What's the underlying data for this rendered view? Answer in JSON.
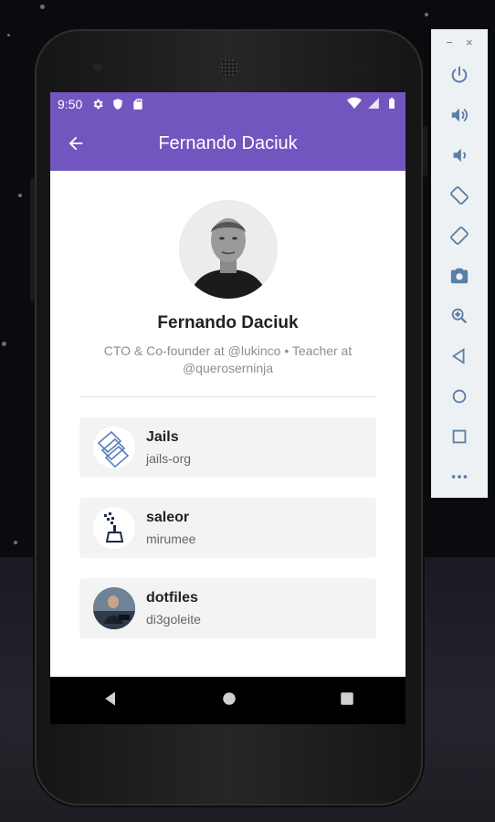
{
  "status_bar": {
    "time": "9:50",
    "left_icons": [
      "settings-icon",
      "shield-icon",
      "sd-card-icon"
    ],
    "right_icons": [
      "wifi-icon",
      "signal-icon",
      "battery-icon"
    ]
  },
  "toolbar": {
    "title": "Fernando Daciuk",
    "back_icon": "arrow-left-icon"
  },
  "profile": {
    "name": "Fernando Daciuk",
    "bio_line1": "CTO & Co-founder at @lukinco • Teacher at",
    "bio_line2": "@queroserninja"
  },
  "repos": [
    {
      "name": "Jails",
      "owner": "jails-org"
    },
    {
      "name": "saleor",
      "owner": "mirumee"
    },
    {
      "name": "dotfiles",
      "owner": "di3goleite"
    }
  ],
  "emulator_controls": {
    "minimize_label": "−",
    "close_label": "×",
    "buttons": [
      "power-icon",
      "volume-up-icon",
      "volume-down-icon",
      "rotate-left-icon",
      "rotate-right-icon",
      "camera-icon",
      "zoom-icon",
      "back-icon",
      "home-icon",
      "overview-icon",
      "more-icon"
    ]
  },
  "colors": {
    "primary": "#7256c0",
    "card_bg": "#f3f3f3",
    "emulator_icon": "#5b7fa6"
  }
}
